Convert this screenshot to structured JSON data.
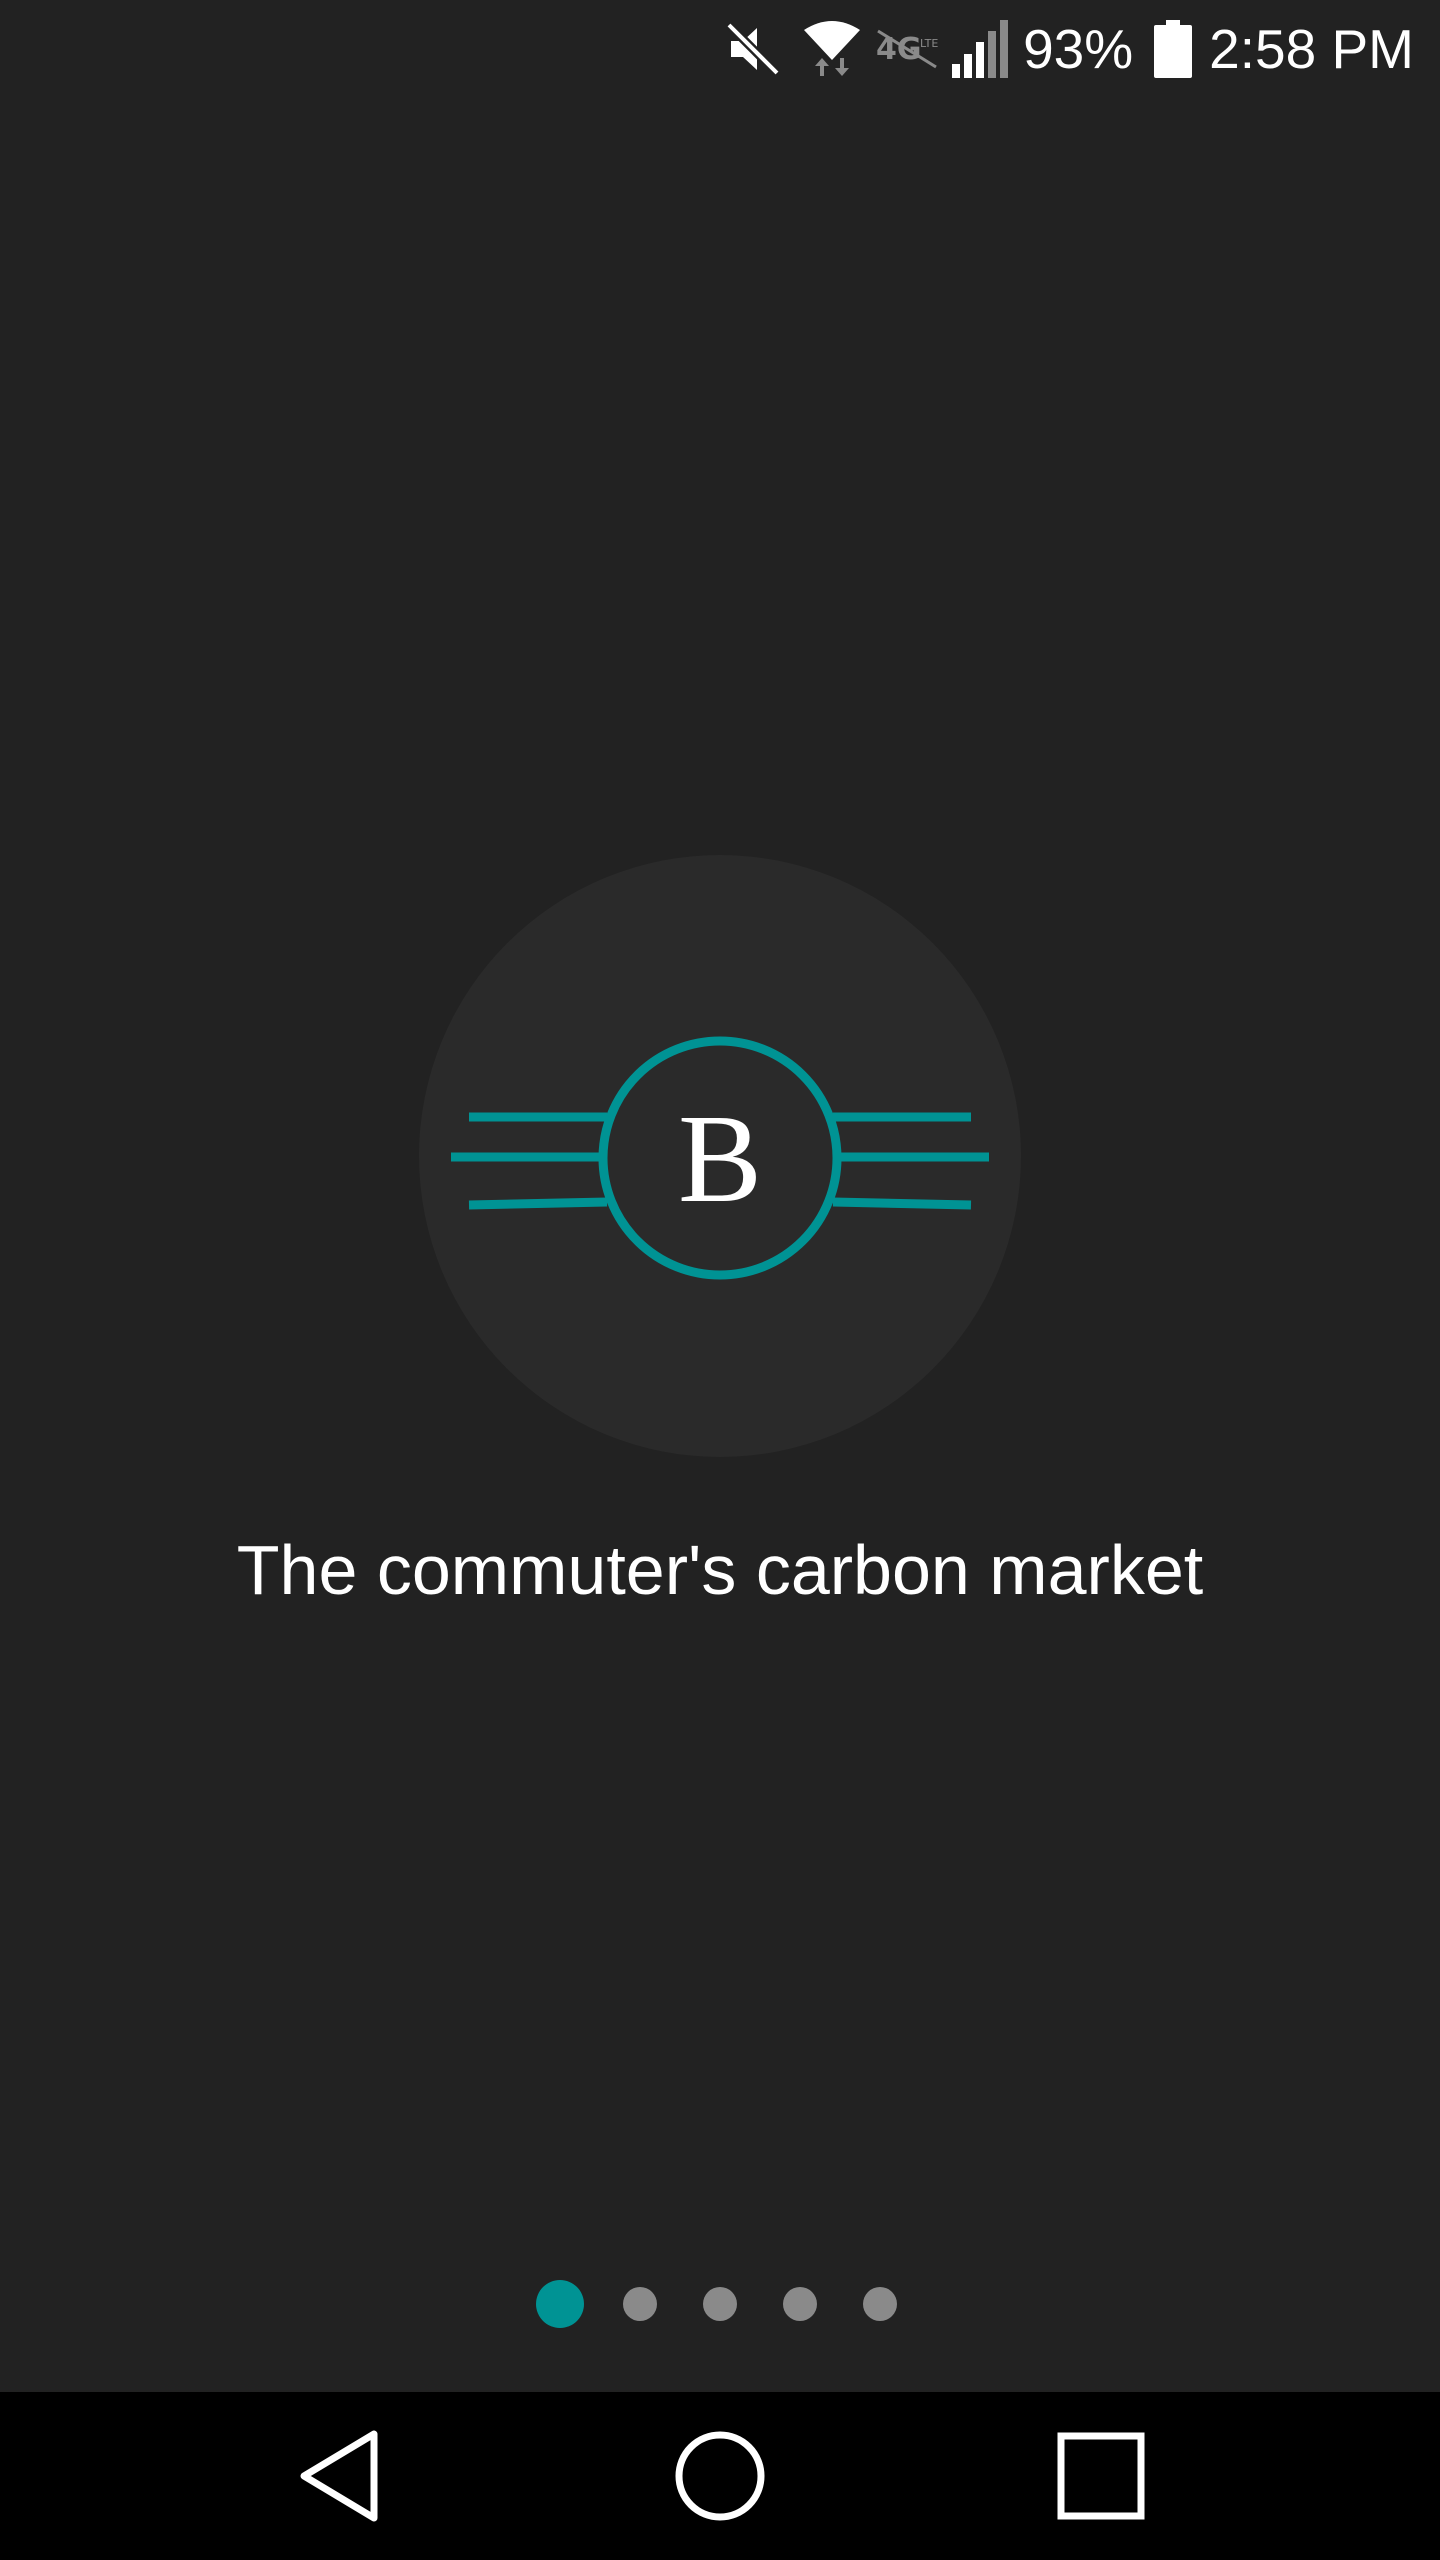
{
  "status_bar": {
    "icons": [
      "mute-icon",
      "wifi-icon",
      "lte-icon",
      "signal-icon",
      "battery-icon"
    ],
    "battery_percent": "93%",
    "time": "2:58 PM"
  },
  "logo": {
    "letter": "B",
    "accent_color": "#009394"
  },
  "tagline": "The commuter's carbon market",
  "pager": {
    "total_pages": 5,
    "current_page": 1,
    "active_color": "#009394",
    "inactive_color": "#8a8a8a"
  },
  "nav_bar": {
    "buttons": [
      "back-icon",
      "home-icon",
      "recents-icon"
    ]
  }
}
